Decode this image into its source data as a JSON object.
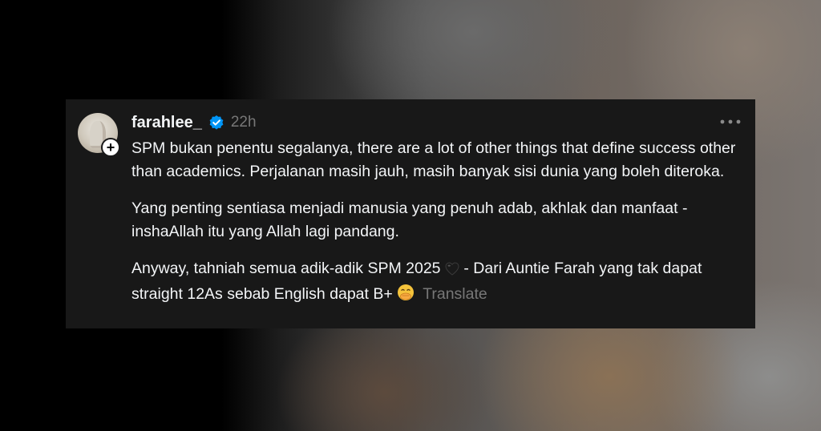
{
  "post": {
    "username": "farahlee_",
    "timestamp": "22h",
    "verified": true,
    "more_icon": "ellipsis-horizontal-icon",
    "follow_icon": "plus-icon",
    "paragraphs": {
      "p1": "SPM bukan penentu segalanya, there are a lot of other things that define success other than academics. Perjalanan masih jauh, masih banyak sisi dunia yang boleh diteroka.",
      "p2": "Yang penting sentiasa menjadi manusia yang penuh adab, akhlak dan manfaat - inshaAllah itu yang Allah lagi pandang.",
      "p3_part1": "Anyway, tahniah semua adik-adik SPM 2025",
      "p3_part2": " - Dari Auntie Farah yang tak dapat straight 12As sebab English dapat B+"
    },
    "emojis": [
      "black-heart-emoji",
      "face-with-hand-over-mouth-emoji"
    ],
    "translate_label": "Translate"
  },
  "colors": {
    "card_background": "#181818",
    "text_primary": "#f3f5f7",
    "text_secondary": "#777777",
    "verified_blue": "#0095f6"
  }
}
